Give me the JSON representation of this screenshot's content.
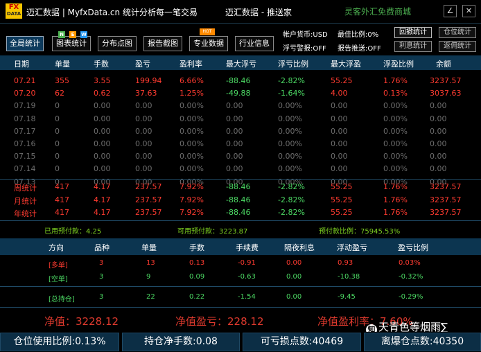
{
  "titlebar": {
    "logo_top": "FX",
    "logo_bottom": "DATA",
    "app_title": "迈汇数据 | MyfxData.cn  统计分析每一笔交易",
    "center_title": "迈汇数据 - 推送家",
    "shop_link": "灵客外汇免费商城",
    "min_symbol": "∠",
    "close_symbol": "✕"
  },
  "toolbar": {
    "buttons": [
      "全局统计",
      "图表统计",
      "分布点图",
      "报告截图",
      "专业数据",
      "行业信息"
    ],
    "new_badges": [
      "N",
      "E",
      "W"
    ],
    "hot_badge": "HOT",
    "account_currency": "帐户货币:USD",
    "profit_ratio": "最佳比例:0%",
    "float_alert": "浮亏警报:OFF",
    "report_push": "报告推送:OFF",
    "small_buttons": [
      "回撤统计",
      "仓位统计",
      "利息统计",
      "返佣统计"
    ]
  },
  "table": {
    "headers": [
      "日期",
      "单量",
      "手数",
      "盈亏",
      "盈利率",
      "最大浮亏",
      "浮亏比例",
      "最大浮盈",
      "浮盈比例",
      "余额"
    ],
    "rows": [
      {
        "date": "07.21",
        "count": "355",
        "lots": "3.55",
        "pnl": "199.94",
        "rate": "6.66%",
        "maxloss": "-88.46",
        "lossratio": "-2.82%",
        "maxgain": "55.25",
        "gainratio": "1.76%",
        "balance": "3237.57",
        "style": "red"
      },
      {
        "date": "07.20",
        "count": "62",
        "lots": "0.62",
        "pnl": "37.63",
        "rate": "1.25%",
        "maxloss": "-49.88",
        "lossratio": "-1.64%",
        "maxgain": "4.00",
        "gainratio": "0.13%",
        "balance": "3037.63",
        "style": "red"
      },
      {
        "date": "07.19",
        "count": "0",
        "lots": "0.00",
        "pnl": "0.00",
        "rate": "0.00%",
        "maxloss": "0.00",
        "lossratio": "0.00%",
        "maxgain": "0.00",
        "gainratio": "0.00%",
        "balance": "0.00",
        "style": "grey"
      },
      {
        "date": "07.18",
        "count": "0",
        "lots": "0.00",
        "pnl": "0.00",
        "rate": "0.00%",
        "maxloss": "0.00",
        "lossratio": "0.00%",
        "maxgain": "0.00",
        "gainratio": "0.00%",
        "balance": "0.00",
        "style": "grey"
      },
      {
        "date": "07.17",
        "count": "0",
        "lots": "0.00",
        "pnl": "0.00",
        "rate": "0.00%",
        "maxloss": "0.00",
        "lossratio": "0.00%",
        "maxgain": "0.00",
        "gainratio": "0.00%",
        "balance": "0.00",
        "style": "grey"
      },
      {
        "date": "07.16",
        "count": "0",
        "lots": "0.00",
        "pnl": "0.00",
        "rate": "0.00%",
        "maxloss": "0.00",
        "lossratio": "0.00%",
        "maxgain": "0.00",
        "gainratio": "0.00%",
        "balance": "0.00",
        "style": "grey"
      },
      {
        "date": "07.15",
        "count": "0",
        "lots": "0.00",
        "pnl": "0.00",
        "rate": "0.00%",
        "maxloss": "0.00",
        "lossratio": "0.00%",
        "maxgain": "0.00",
        "gainratio": "0.00%",
        "balance": "0.00",
        "style": "grey"
      },
      {
        "date": "07.14",
        "count": "0",
        "lots": "0.00",
        "pnl": "0.00",
        "rate": "0.00%",
        "maxloss": "0.00",
        "lossratio": "0.00%",
        "maxgain": "0.00",
        "gainratio": "0.00%",
        "balance": "0.00",
        "style": "grey"
      },
      {
        "date": "07.13",
        "count": "0",
        "lots": "0.00",
        "pnl": "0.00",
        "rate": "0.00%",
        "maxloss": "0.00",
        "lossratio": "0.00%",
        "maxgain": "0.00",
        "gainratio": "0.00%",
        "balance": "0.00",
        "style": "grey"
      }
    ],
    "totals": [
      {
        "date": "周统计",
        "count": "417",
        "lots": "4.17",
        "pnl": "237.57",
        "rate": "7.92%",
        "maxloss": "-88.46",
        "lossratio": "-2.82%",
        "maxgain": "55.25",
        "gainratio": "1.76%",
        "balance": "3237.57"
      },
      {
        "date": "月统计",
        "count": "417",
        "lots": "4.17",
        "pnl": "237.57",
        "rate": "7.92%",
        "maxloss": "-88.46",
        "lossratio": "-2.82%",
        "maxgain": "55.25",
        "gainratio": "1.76%",
        "balance": "3237.57"
      },
      {
        "date": "年统计",
        "count": "417",
        "lots": "4.17",
        "pnl": "237.57",
        "rate": "7.92%",
        "maxloss": "-88.46",
        "lossratio": "-2.82%",
        "maxgain": "55.25",
        "gainratio": "1.76%",
        "balance": "3237.57"
      }
    ]
  },
  "summary": {
    "used_margin": "已用预付款：4.25",
    "free_margin": "可用预付款：3223.87",
    "margin_ratio": "预付款比例：75945.53%"
  },
  "positions": {
    "headers": [
      "方向",
      "品种",
      "单量",
      "手数",
      "手续费",
      "隔夜利息",
      "浮动盈亏",
      "盈亏比例"
    ],
    "rows": [
      {
        "dir": "[多单]",
        "sym": "3",
        "count": "13",
        "lots": "0.13",
        "fee": "-0.91",
        "swap": "0.00",
        "float": "0.93",
        "ratio": "0.03%",
        "style": "red"
      },
      {
        "dir": "[空单]",
        "sym": "3",
        "count": "9",
        "lots": "0.09",
        "fee": "-0.63",
        "swap": "0.00",
        "float": "-10.38",
        "ratio": "-0.32%",
        "style": "green"
      },
      {
        "dir": "[总持仓]",
        "sym": "3",
        "count": "22",
        "lots": "0.22",
        "fee": "-1.54",
        "swap": "0.00",
        "float": "-9.45",
        "ratio": "-0.29%",
        "style": "green"
      }
    ]
  },
  "equity": {
    "net_value": "净值：3228.12",
    "net_pnl": "净值盈亏：228.12",
    "net_rate": "净值盈利率：7.60%"
  },
  "statusbar": {
    "position_ratio": "仓位使用比例:0.13%",
    "net_lots": "持仓净手数:0.08",
    "stop_points": "可亏损点数:40469",
    "liquidation_points": "离爆仓点数:40350"
  },
  "watermark": {
    "icon": "知",
    "text": "天青色等烟雨∑"
  }
}
